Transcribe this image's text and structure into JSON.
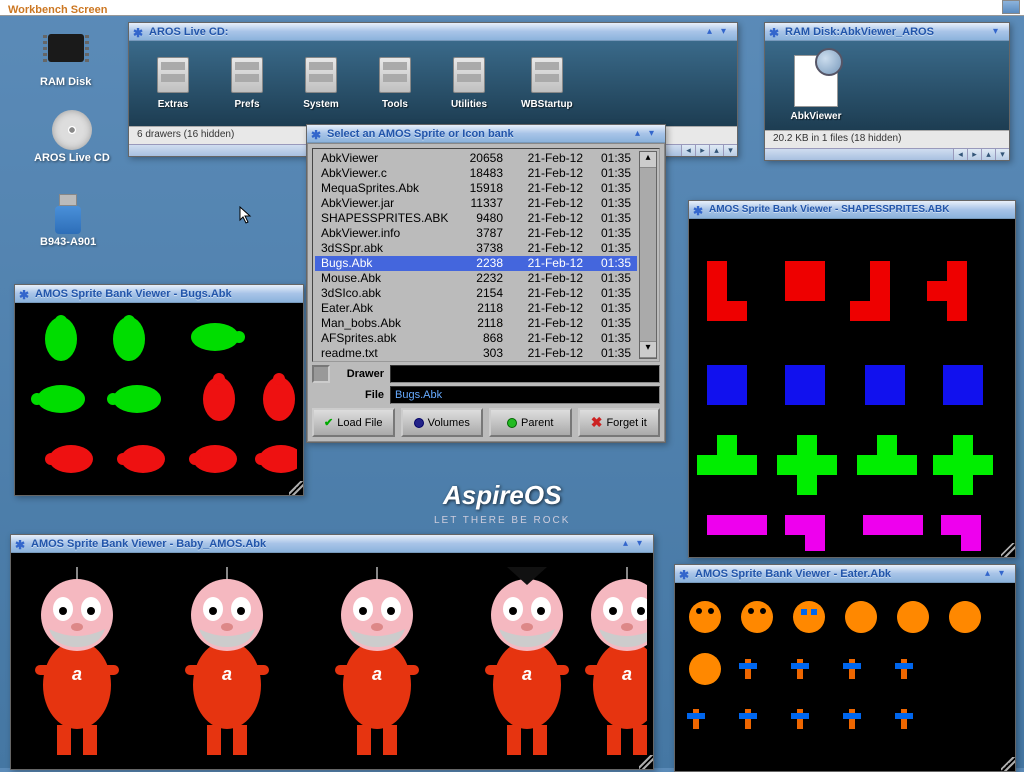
{
  "topbar": {
    "title": "Workbench Screen"
  },
  "desktop": {
    "ram": "RAM Disk",
    "cd": "AROS Live CD",
    "usb": "B943-A901"
  },
  "livecd": {
    "title": "AROS Live CD:",
    "drawers": [
      "Extras",
      "Prefs",
      "System",
      "Tools",
      "Utilities",
      "WBStartup"
    ],
    "status": "6 drawers (16 hidden)"
  },
  "ramdisk": {
    "title": "RAM Disk:AbkViewer_AROS",
    "icon_label": "AbkViewer",
    "status": "20.2 KB in 1 files (18 hidden)"
  },
  "selector": {
    "title": "Select an AMOS Sprite or Icon bank",
    "files": [
      {
        "n": "AbkViewer",
        "s": "20658",
        "d": "21-Feb-12",
        "t": "01:35"
      },
      {
        "n": "AbkViewer.c",
        "s": "18483",
        "d": "21-Feb-12",
        "t": "01:35"
      },
      {
        "n": "MequaSprites.Abk",
        "s": "15918",
        "d": "21-Feb-12",
        "t": "01:35"
      },
      {
        "n": "AbkViewer.jar",
        "s": "11337",
        "d": "21-Feb-12",
        "t": "01:35"
      },
      {
        "n": "SHAPESSPRITES.ABK",
        "s": "9480",
        "d": "21-Feb-12",
        "t": "01:35"
      },
      {
        "n": "AbkViewer.info",
        "s": "3787",
        "d": "21-Feb-12",
        "t": "01:35"
      },
      {
        "n": "3dSSpr.abk",
        "s": "3738",
        "d": "21-Feb-12",
        "t": "01:35"
      },
      {
        "n": "Bugs.Abk",
        "s": "2238",
        "d": "21-Feb-12",
        "t": "01:35",
        "sel": true
      },
      {
        "n": "Mouse.Abk",
        "s": "2232",
        "d": "21-Feb-12",
        "t": "01:35"
      },
      {
        "n": "3dSIco.abk",
        "s": "2154",
        "d": "21-Feb-12",
        "t": "01:35"
      },
      {
        "n": "Eater.Abk",
        "s": "2118",
        "d": "21-Feb-12",
        "t": "01:35"
      },
      {
        "n": "Man_bobs.Abk",
        "s": "2118",
        "d": "21-Feb-12",
        "t": "01:35"
      },
      {
        "n": "AFSprites.abk",
        "s": "868",
        "d": "21-Feb-12",
        "t": "01:35"
      },
      {
        "n": "readme.txt",
        "s": "303",
        "d": "21-Feb-12",
        "t": "01:35"
      }
    ],
    "drawer_label": "Drawer",
    "drawer_value": "",
    "file_label": "File",
    "file_value": "Bugs.Abk",
    "btn_load": "Load File",
    "btn_volumes": "Volumes",
    "btn_parent": "Parent",
    "btn_forget": "Forget it"
  },
  "viewer_bugs": {
    "title": "AMOS Sprite Bank Viewer - Bugs.Abk"
  },
  "viewer_shapes": {
    "title": "AMOS Sprite Bank Viewer - SHAPESSPRITES.ABK"
  },
  "viewer_baby": {
    "title": "AMOS Sprite Bank Viewer - Baby_AMOS.Abk"
  },
  "viewer_eater": {
    "title": "AMOS Sprite Bank Viewer - Eater.Abk"
  },
  "brand": {
    "name": "AspireOS",
    "tag": "LET THERE BE ROCK"
  }
}
